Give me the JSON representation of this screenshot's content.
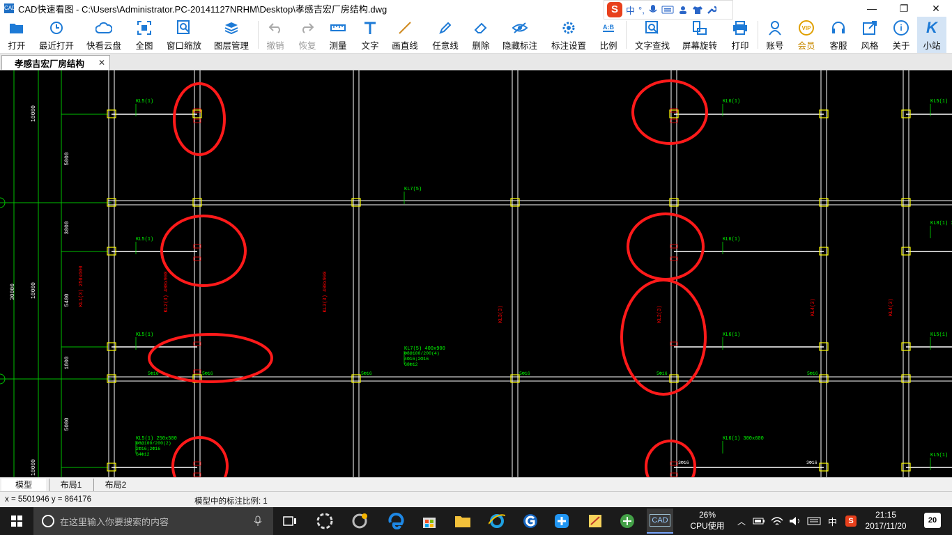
{
  "window": {
    "logo": "CAD",
    "title": "CAD快速看图 - C:\\Users\\Administrator.PC-20141127NRHM\\Desktop\\孝感吉宏厂房结构.dwg",
    "minimize": "—",
    "maximize": "❐",
    "close": "✕"
  },
  "ime": {
    "logo": "S",
    "mode": "中",
    "punct": "°,"
  },
  "toolbar": {
    "open": "打开",
    "recent": "最近打开",
    "cloud": "快看云盘",
    "fit": "全图",
    "window_zoom": "窗口缩放",
    "layers": "图层管理",
    "undo": "撤销",
    "redo": "恢复",
    "measure": "测量",
    "text": "文字",
    "line": "画直线",
    "freehand": "任意线",
    "delete": "删除",
    "hide_marks": "隐藏标注",
    "mark_settings": "标注设置",
    "ratio": "比例",
    "text_search": "文字查找",
    "rotate": "屏幕旋转",
    "print": "打印",
    "account": "账号",
    "vip": "会员",
    "service": "客服",
    "style": "风格",
    "about": "关于",
    "station": "小站",
    "ratio_glyph": "A:B",
    "vip_glyph": "VIP",
    "about_glyph": "i",
    "station_glyph": "K"
  },
  "tab": {
    "title": "孝感吉宏厂房结构",
    "close": "✕"
  },
  "layouts": {
    "model": "模型",
    "layout1": "布局1",
    "layout2": "布局2"
  },
  "status": {
    "coords": "x = 5501946  y = 864176",
    "scale": "模型中的标注比例: 1"
  },
  "drawing": {
    "dims": [
      "10000",
      "5000",
      "3000",
      "10000",
      "5400",
      "1800",
      "5000",
      "10000",
      "30000"
    ],
    "beam_labels": [
      "KL5(1)",
      "KL6(1)",
      "KL7(5)",
      "KL5(1)",
      "KL6(1)",
      "KL5(1)",
      "KL6(1)",
      "KL5(1) 250x500",
      "KL6(1) 300x600",
      "KL7(5) 400x900",
      "KL5(1)",
      "KL5(1)",
      "KL8(1) 30",
      "KL5(1)"
    ],
    "spec_lines": [
      "Φ8@100/200(2)",
      "2Φ16;2Φ16",
      "G4Φ12",
      "Φ8@100/200(4)",
      "4Φ16;2Φ16",
      "G8Φ12"
    ],
    "rebar_labels": [
      "5Φ16",
      "5Φ16",
      "5Φ16",
      "5Φ16",
      "5Φ16",
      "5Φ16",
      "3Φ16",
      "3Φ16"
    ],
    "red_labels": [
      "KL2(3) 400x900",
      "KL3(3) 400x900",
      "KL1(3) 250x600",
      "KL3(3)",
      "KL2(3)",
      "KL4(3)",
      "KL4(3)"
    ]
  },
  "taskbar": {
    "search_placeholder": "在这里输入你要搜索的内容",
    "cpu_percent": "26%",
    "cpu_label": "CPU使用",
    "ime": "中",
    "time": "21:15",
    "date": "2017/11/20",
    "notifications": "20",
    "active_app": "CAD"
  },
  "colors": {
    "canvas": "#000000",
    "grid": "#ffffff",
    "axis": "#00c000",
    "label": "#00ff00",
    "annotation": "#ff0000",
    "column": "#ffff00"
  }
}
